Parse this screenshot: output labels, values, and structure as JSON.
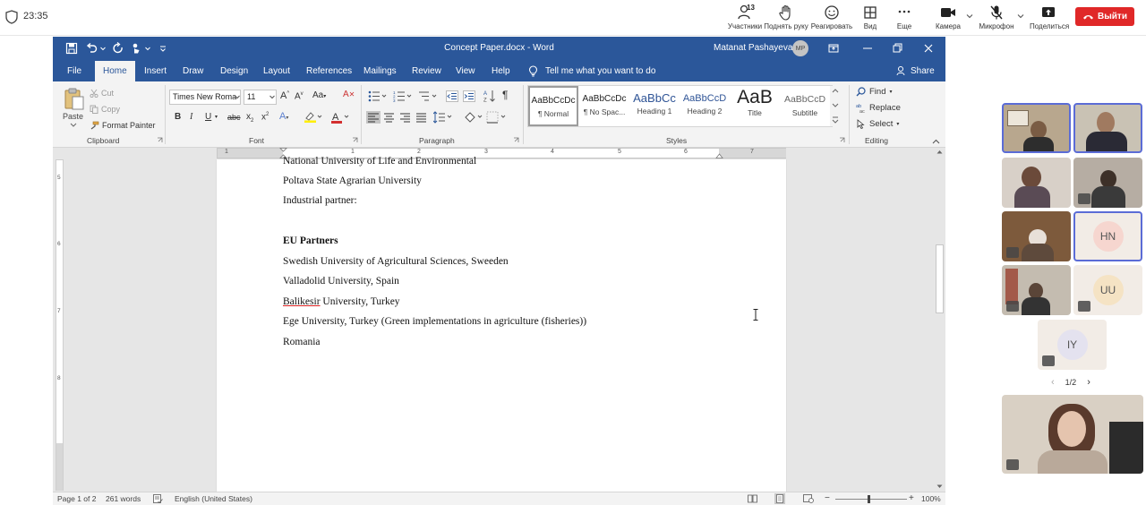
{
  "zoom": {
    "time": "23:35",
    "participants_count": "13",
    "participants_label": "Участники",
    "raise_hand_label": "Поднять руку",
    "react_label": "Реагировать",
    "view_label": "Вид",
    "more_label": "Еще",
    "camera_label": "Камера",
    "mic_label": "Микрофон",
    "share_label": "Поделиться",
    "leave_label": "Выйти",
    "accent_color": "#e02828"
  },
  "word": {
    "title": "Concept Paper.docx  -  Word",
    "user_name": "Matanat Pashayeva",
    "user_initials": "MP",
    "menu": [
      "File",
      "Home",
      "Insert",
      "Draw",
      "Design",
      "Layout",
      "References",
      "Mailings",
      "Review",
      "View",
      "Help"
    ],
    "tell_me": "Tell me what you want to do",
    "share": "Share",
    "ribbon": {
      "clipboard": {
        "paste": "Paste",
        "cut": "Cut",
        "copy": "Copy",
        "format_painter": "Format Painter",
        "label": "Clipboard"
      },
      "font": {
        "name": "Times New Roma",
        "size": "11",
        "label": "Font"
      },
      "paragraph": {
        "label": "Paragraph"
      },
      "styles": {
        "label": "Styles",
        "items": [
          {
            "preview": "AaBbCcDc",
            "name": "¶ Normal"
          },
          {
            "preview": "AaBbCcDc",
            "name": "¶ No Spac..."
          },
          {
            "preview": "AaBbCc",
            "name": "Heading 1"
          },
          {
            "preview": "AaBbCcD",
            "name": "Heading 2"
          },
          {
            "preview": "AaB",
            "name": "Title"
          },
          {
            "preview": "AaBbCcD",
            "name": "Subtitle"
          }
        ]
      },
      "editing": {
        "find": "Find",
        "replace": "Replace",
        "select": "Select",
        "label": "Editing"
      }
    },
    "document": {
      "lines": [
        "National University of Life and Environmental",
        "Poltava State Agrarian University",
        "Industrial partner:",
        "EU Partners",
        "Swedish University of Agricultural Sciences, Sweeden",
        "Valladolid University, Spain",
        "Balikesir",
        " University, Turkey",
        "Ege University, Turkey (Green implementations in agriculture (fisheries))",
        "Romania"
      ]
    },
    "status": {
      "page": "Page 1 of 2",
      "words": "261 words",
      "language": "English (United States)",
      "zoom": "100%"
    },
    "ruler_numbers": [
      "1",
      "1",
      "2",
      "3",
      "4",
      "5",
      "6",
      "7"
    ],
    "vruler_numbers": [
      "5",
      "6",
      "7",
      "8"
    ]
  },
  "participants": {
    "initials": [
      "HN",
      "UU",
      "IY"
    ],
    "pager": "1/2"
  }
}
